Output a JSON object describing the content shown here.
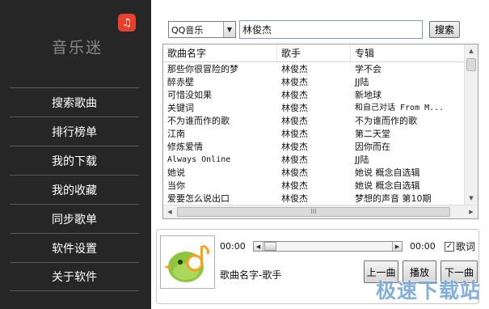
{
  "app": {
    "title": "音乐迷",
    "logo_icon": "music-note-icon",
    "accent": "#e8402c"
  },
  "sidebar": {
    "items": [
      {
        "label": "搜索歌曲"
      },
      {
        "label": "排行榜单"
      },
      {
        "label": "我的下载"
      },
      {
        "label": "我的收藏"
      },
      {
        "label": "同步歌单"
      },
      {
        "label": "软件设置"
      },
      {
        "label": "关于软件"
      }
    ]
  },
  "search": {
    "source": "QQ音乐",
    "query": "林俊杰",
    "button_label": "搜索"
  },
  "results": {
    "columns": [
      "歌曲名字",
      "歌手",
      "专辑"
    ],
    "rows": [
      {
        "song": "那些你很冒险的梦",
        "artist": "林俊杰",
        "album": "学不会"
      },
      {
        "song": "醉赤壁",
        "artist": "林俊杰",
        "album": "JJ陆"
      },
      {
        "song": "可惜没如果",
        "artist": "林俊杰",
        "album": "新地球"
      },
      {
        "song": "关键词",
        "artist": "林俊杰",
        "album": "和自己对话 From M..."
      },
      {
        "song": "不为谁而作的歌",
        "artist": "林俊杰",
        "album": "不为谁而作的歌"
      },
      {
        "song": "江南",
        "artist": "林俊杰",
        "album": "第二天堂"
      },
      {
        "song": "修炼爱情",
        "artist": "林俊杰",
        "album": "因你而在"
      },
      {
        "song": "Always Online",
        "artist": "林俊杰",
        "album": "JJ陆"
      },
      {
        "song": "她说",
        "artist": "林俊杰",
        "album": "她说 概念自选辑"
      },
      {
        "song": "当你",
        "artist": "林俊杰",
        "album": "她说 概念自选辑"
      },
      {
        "song": "爱要怎么说出口",
        "artist": "林俊杰",
        "album": "梦想的声音 第10期"
      }
    ],
    "hscroll_grip": "III"
  },
  "player": {
    "time_current": "00:00",
    "time_total": "00:00",
    "lyrics_label": "歌词",
    "lyrics_checked": true,
    "track": "歌曲名字-歌手",
    "prev_label": "上一曲",
    "play_label": "播放",
    "next_label": "下一曲",
    "cover_icon": "bird-music-icon",
    "cover_color": "#8cc63f"
  },
  "watermark": "极速下载站"
}
